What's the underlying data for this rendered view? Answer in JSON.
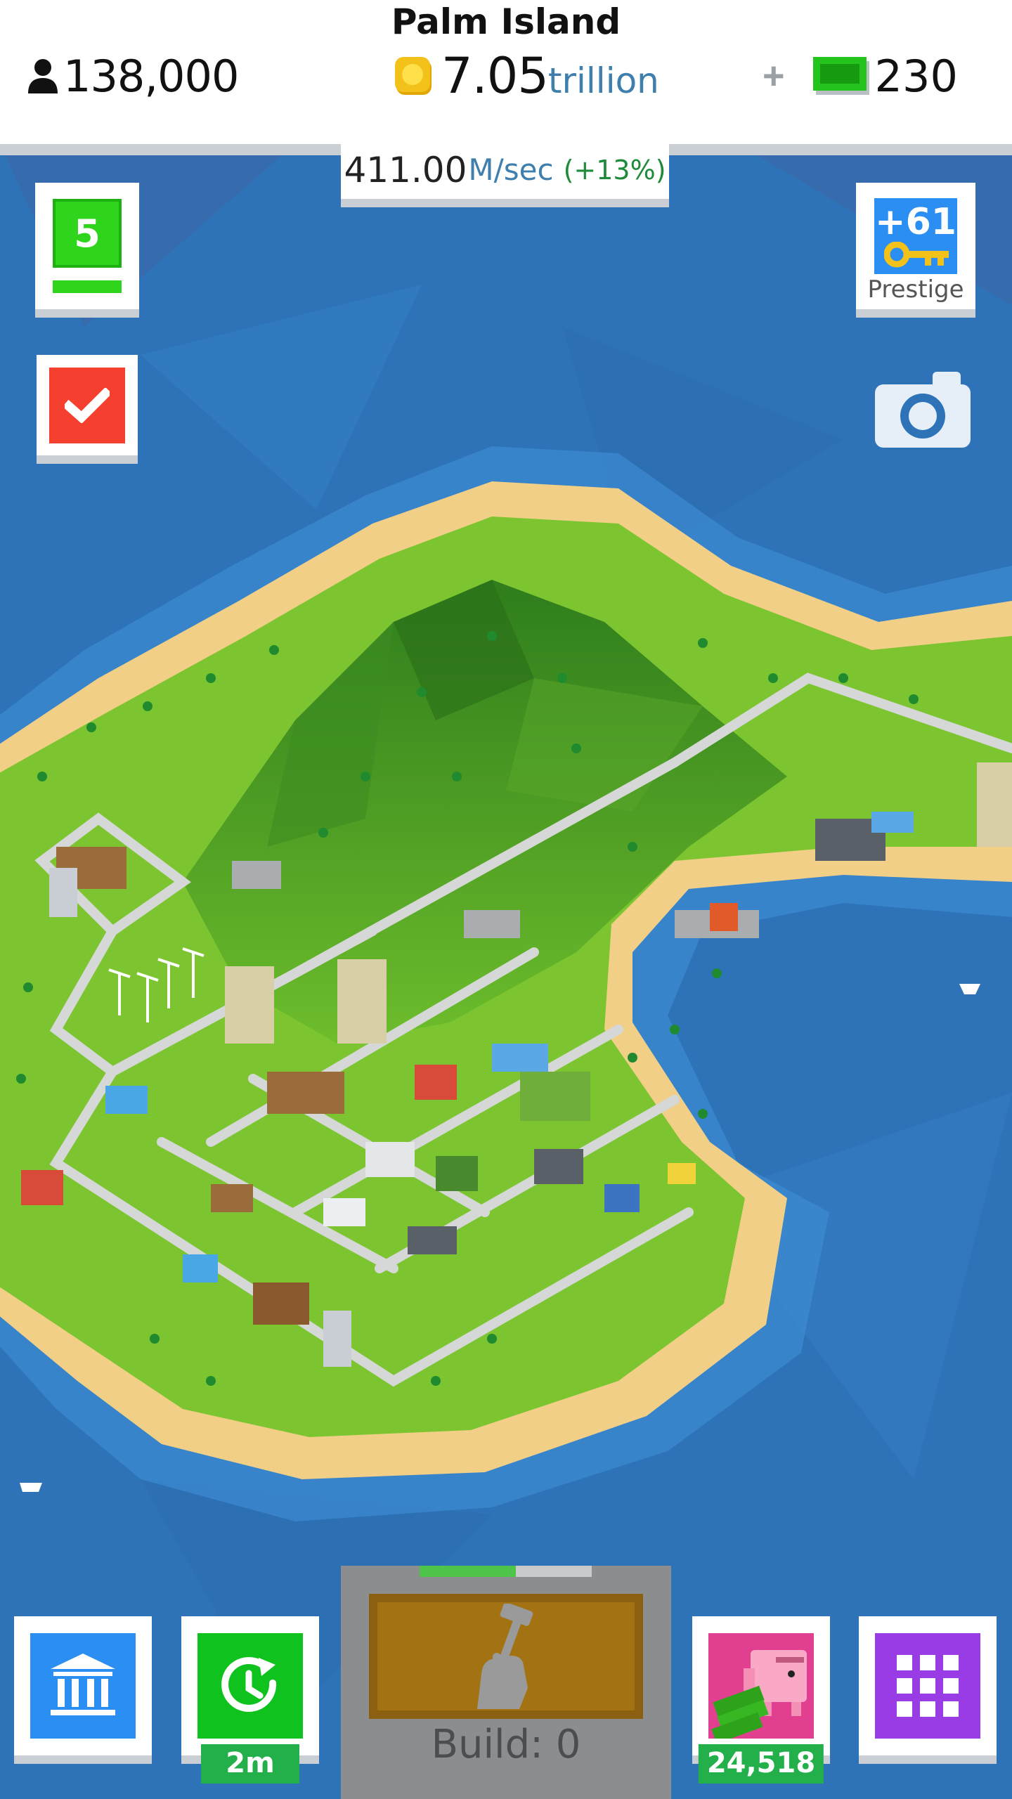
{
  "header": {
    "city_name": "Palm Island",
    "population": "138,000",
    "money_value": "7.05",
    "money_unit": "trillion",
    "cash_plus": "+",
    "cash_value": "230"
  },
  "income": {
    "rate_value": "411.00",
    "rate_unit": "M/sec",
    "rate_bonus": "(+13%)"
  },
  "side_buttons": {
    "level": "5",
    "prestige_count": "+61",
    "prestige_label": "Prestige"
  },
  "bottom_bar": {
    "boost_timer": "2m",
    "piggy_bank_amount": "24,518",
    "build_label": "Build: 0",
    "build_progress": 0.56
  },
  "icons": [
    "person-icon",
    "coin-icon",
    "cash-icon",
    "check-icon",
    "key-icon",
    "camera-icon",
    "bank-icon",
    "time-boost-icon",
    "build-hammer-icon",
    "piggy-bank-icon",
    "grid-menu-icon"
  ],
  "colors": {
    "ocean": "#2e73b8",
    "grass": "#7cc531",
    "sand": "#f1cf86",
    "accent_green": "#2fd41c",
    "accent_blue": "#2a8ef2",
    "accent_red": "#f5402f",
    "accent_purple": "#9a3ce6",
    "accent_pink": "#e0408f"
  }
}
